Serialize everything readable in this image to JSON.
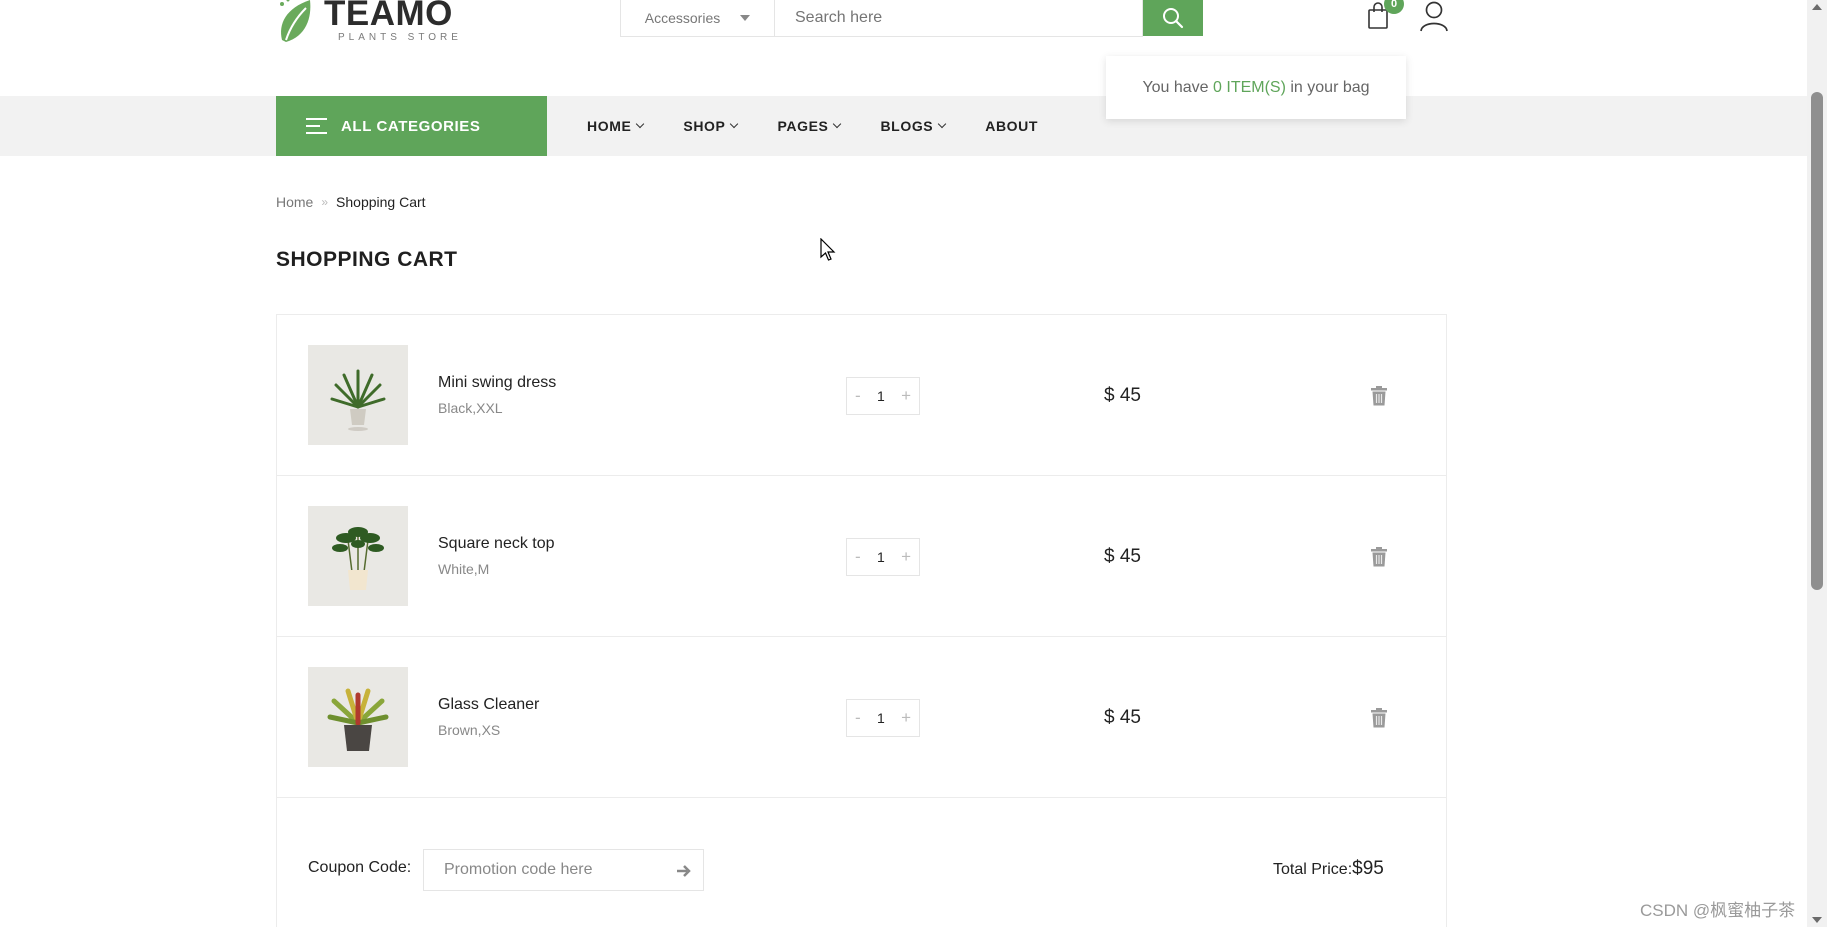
{
  "brand": {
    "name": "TEAMO",
    "tagline": "PLANTS STORE",
    "accent_color": "#5fa55a"
  },
  "search": {
    "category": "Accessories",
    "placeholder": "Search here"
  },
  "cart_badge": {
    "count": "0"
  },
  "bag_popup": {
    "prefix": "You have",
    "count_text": "0 ITEM(S)",
    "suffix": "in your bag"
  },
  "nav": {
    "all_categories": "ALL CATEGORIES",
    "items": [
      {
        "label": "HOME",
        "has_dropdown": true
      },
      {
        "label": "SHOP",
        "has_dropdown": true
      },
      {
        "label": "PAGES",
        "has_dropdown": true
      },
      {
        "label": "BLOGS",
        "has_dropdown": true
      },
      {
        "label": "ABOUT",
        "has_dropdown": false
      }
    ]
  },
  "breadcrumb": {
    "home": "Home",
    "separator": "»",
    "current": "Shopping Cart"
  },
  "page_title": "SHOPPING CART",
  "cart": {
    "items": [
      {
        "name": "Mini swing dress",
        "variant": "Black,XXL",
        "qty": "1",
        "price": "$ 45",
        "image": "potted-palm-plant"
      },
      {
        "name": "Square neck top",
        "variant": "White,M",
        "qty": "1",
        "price": "$ 45",
        "image": "potted-bamboo-plant"
      },
      {
        "name": "Glass Cleaner",
        "variant": "Brown,XS",
        "qty": "1",
        "price": "$ 45",
        "image": "potted-bromeliad-plant"
      }
    ],
    "qty_minus": "-",
    "qty_plus": "+",
    "coupon_label": "Coupon Code:",
    "coupon_placeholder": "Promotion code here",
    "total_label": "Total Price:",
    "total_value": "$95"
  },
  "watermark": "CSDN @枫蜜柚子茶"
}
